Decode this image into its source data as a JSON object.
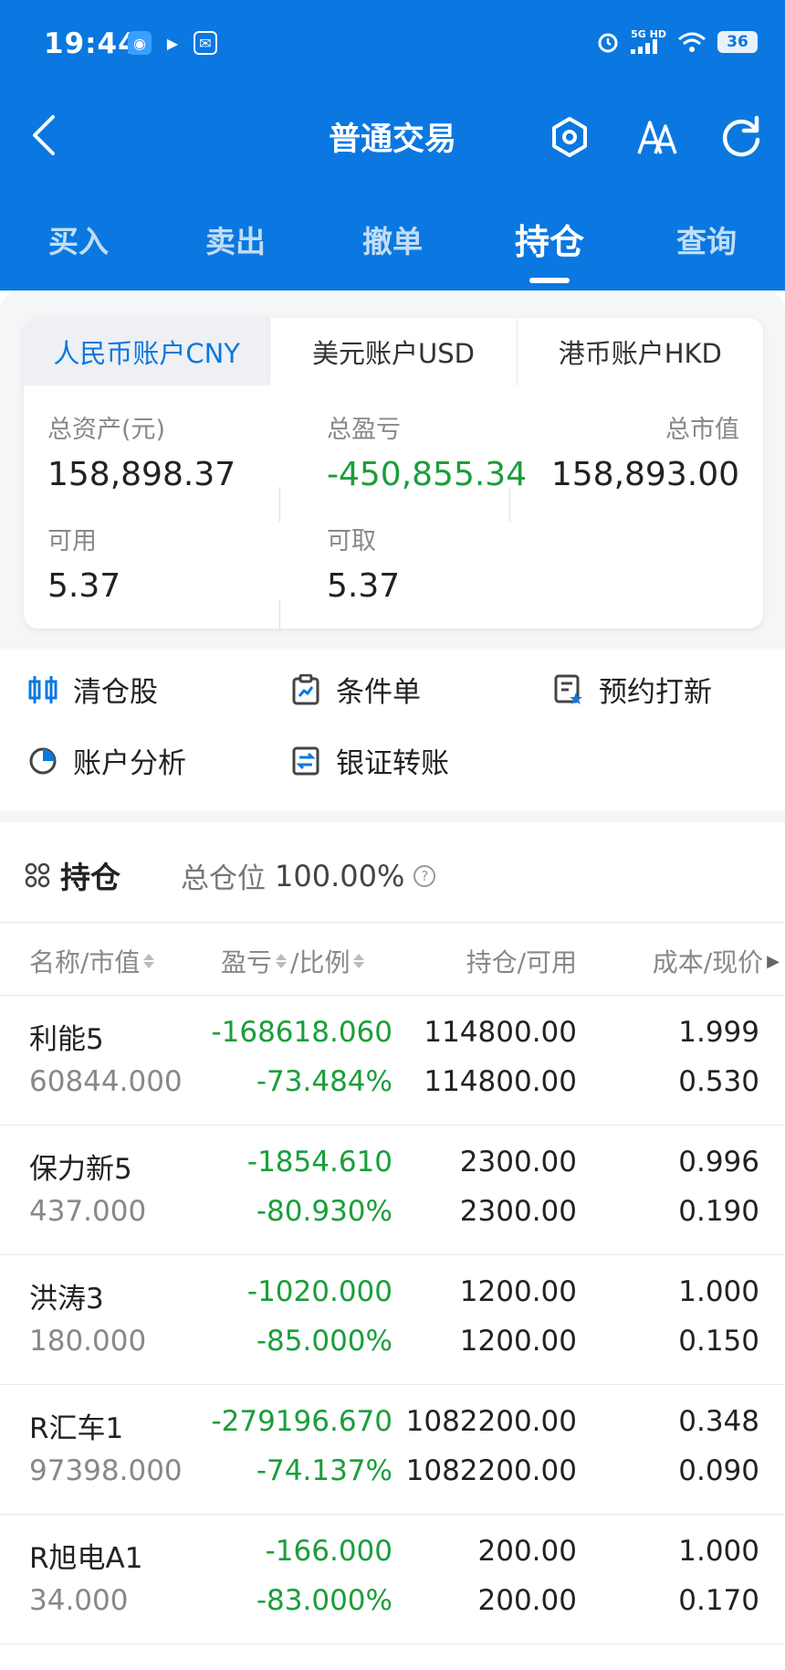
{
  "status": {
    "time": "19:44",
    "network": "5G HD",
    "battery": "36"
  },
  "header": {
    "title": "普通交易"
  },
  "tabs": [
    {
      "label": "买入"
    },
    {
      "label": "卖出"
    },
    {
      "label": "撤单"
    },
    {
      "label": "持仓",
      "active": true
    },
    {
      "label": "查询"
    }
  ],
  "account": {
    "tabs": [
      {
        "label": "人民币账户CNY",
        "active": true
      },
      {
        "label": "美元账户USD"
      },
      {
        "label": "港币账户HKD"
      }
    ],
    "total_assets_label": "总资产(元)",
    "total_assets": "158,898.37",
    "total_pl_label": "总盈亏",
    "total_pl": "-450,855.34",
    "market_value_label": "总市值",
    "market_value": "158,893.00",
    "available_label": "可用",
    "available": "5.37",
    "withdrawable_label": "可取",
    "withdrawable": "5.37"
  },
  "quick_actions": [
    {
      "label": "清仓股",
      "icon": "clear-stock-icon"
    },
    {
      "label": "条件单",
      "icon": "condition-order-icon"
    },
    {
      "label": "预约打新",
      "icon": "ipo-reserve-icon"
    },
    {
      "label": "账户分析",
      "icon": "pie-chart-icon"
    },
    {
      "label": "银证转账",
      "icon": "transfer-icon"
    }
  ],
  "holdings": {
    "title": "持仓",
    "position_ratio_label": "总仓位",
    "position_ratio": "100.00%",
    "columns": {
      "name": "名称/市值",
      "pl": "盈亏",
      "ratio": "/比例",
      "position": "持仓/可用",
      "cost": "成本/现价"
    },
    "rows": [
      {
        "name": "利能5",
        "market_value": "60844.000",
        "pl": "-168618.060",
        "pl_pct": "-73.484%",
        "position": "114800.00",
        "available": "114800.00",
        "cost": "1.999",
        "price": "0.530"
      },
      {
        "name": "保力新5",
        "market_value": "437.000",
        "pl": "-1854.610",
        "pl_pct": "-80.930%",
        "position": "2300.00",
        "available": "2300.00",
        "cost": "0.996",
        "price": "0.190"
      },
      {
        "name": "洪涛3",
        "market_value": "180.000",
        "pl": "-1020.000",
        "pl_pct": "-85.000%",
        "position": "1200.00",
        "available": "1200.00",
        "cost": "1.000",
        "price": "0.150"
      },
      {
        "name": "R汇车1",
        "market_value": "97398.000",
        "pl": "-279196.670",
        "pl_pct": "-74.137%",
        "position": "1082200.00",
        "available": "1082200.00",
        "cost": "0.348",
        "price": "0.090"
      },
      {
        "name": "R旭电A1",
        "market_value": "34.000",
        "pl": "-166.000",
        "pl_pct": "-83.000%",
        "position": "200.00",
        "available": "200.00",
        "cost": "1.000",
        "price": "0.170"
      }
    ]
  },
  "colors": {
    "brand": "#0a78e0",
    "loss": "#1a9e3a"
  }
}
